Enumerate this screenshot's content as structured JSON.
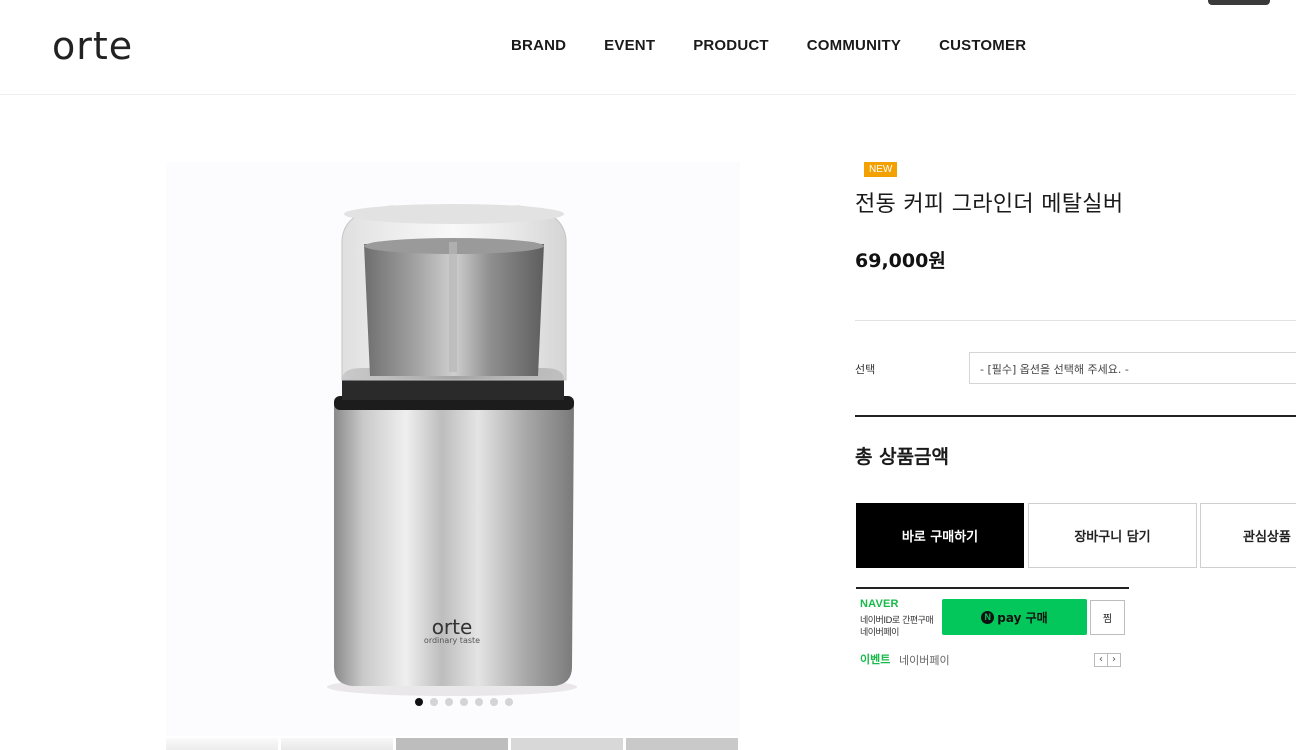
{
  "header": {
    "logo": "orte",
    "nav": [
      "BRAND",
      "EVENT",
      "PRODUCT",
      "COMMUNITY",
      "CUSTOMER"
    ]
  },
  "gallery": {
    "product_logo": "orte",
    "product_tagline": "ordinary taste",
    "dots_total": 7,
    "active_dot": 1
  },
  "product": {
    "badge": "NEW",
    "title": "전동 커피 그라인더 메탈실버",
    "price": "69,000원",
    "option_label": "선택",
    "option_placeholder": "- [필수] 옵션을 선택해 주세요. -",
    "total_label": "총 상품금액"
  },
  "actions": {
    "buy": "바로 구매하기",
    "cart": "장바구니 담기",
    "wish": "관심상품"
  },
  "npay": {
    "brand": "NAVER",
    "sub1": "네이버ID로 간편구매",
    "sub2": "네이버페이",
    "button_n": "N",
    "button_label": "pay 구매",
    "zzim": "찜",
    "event_label": "이벤트",
    "event_text": "네이버페이",
    "prev": "‹",
    "next": "›"
  },
  "colors": {
    "badge": "#f2a100",
    "naver_green": "#03c75a",
    "buy_button": "#000000"
  }
}
